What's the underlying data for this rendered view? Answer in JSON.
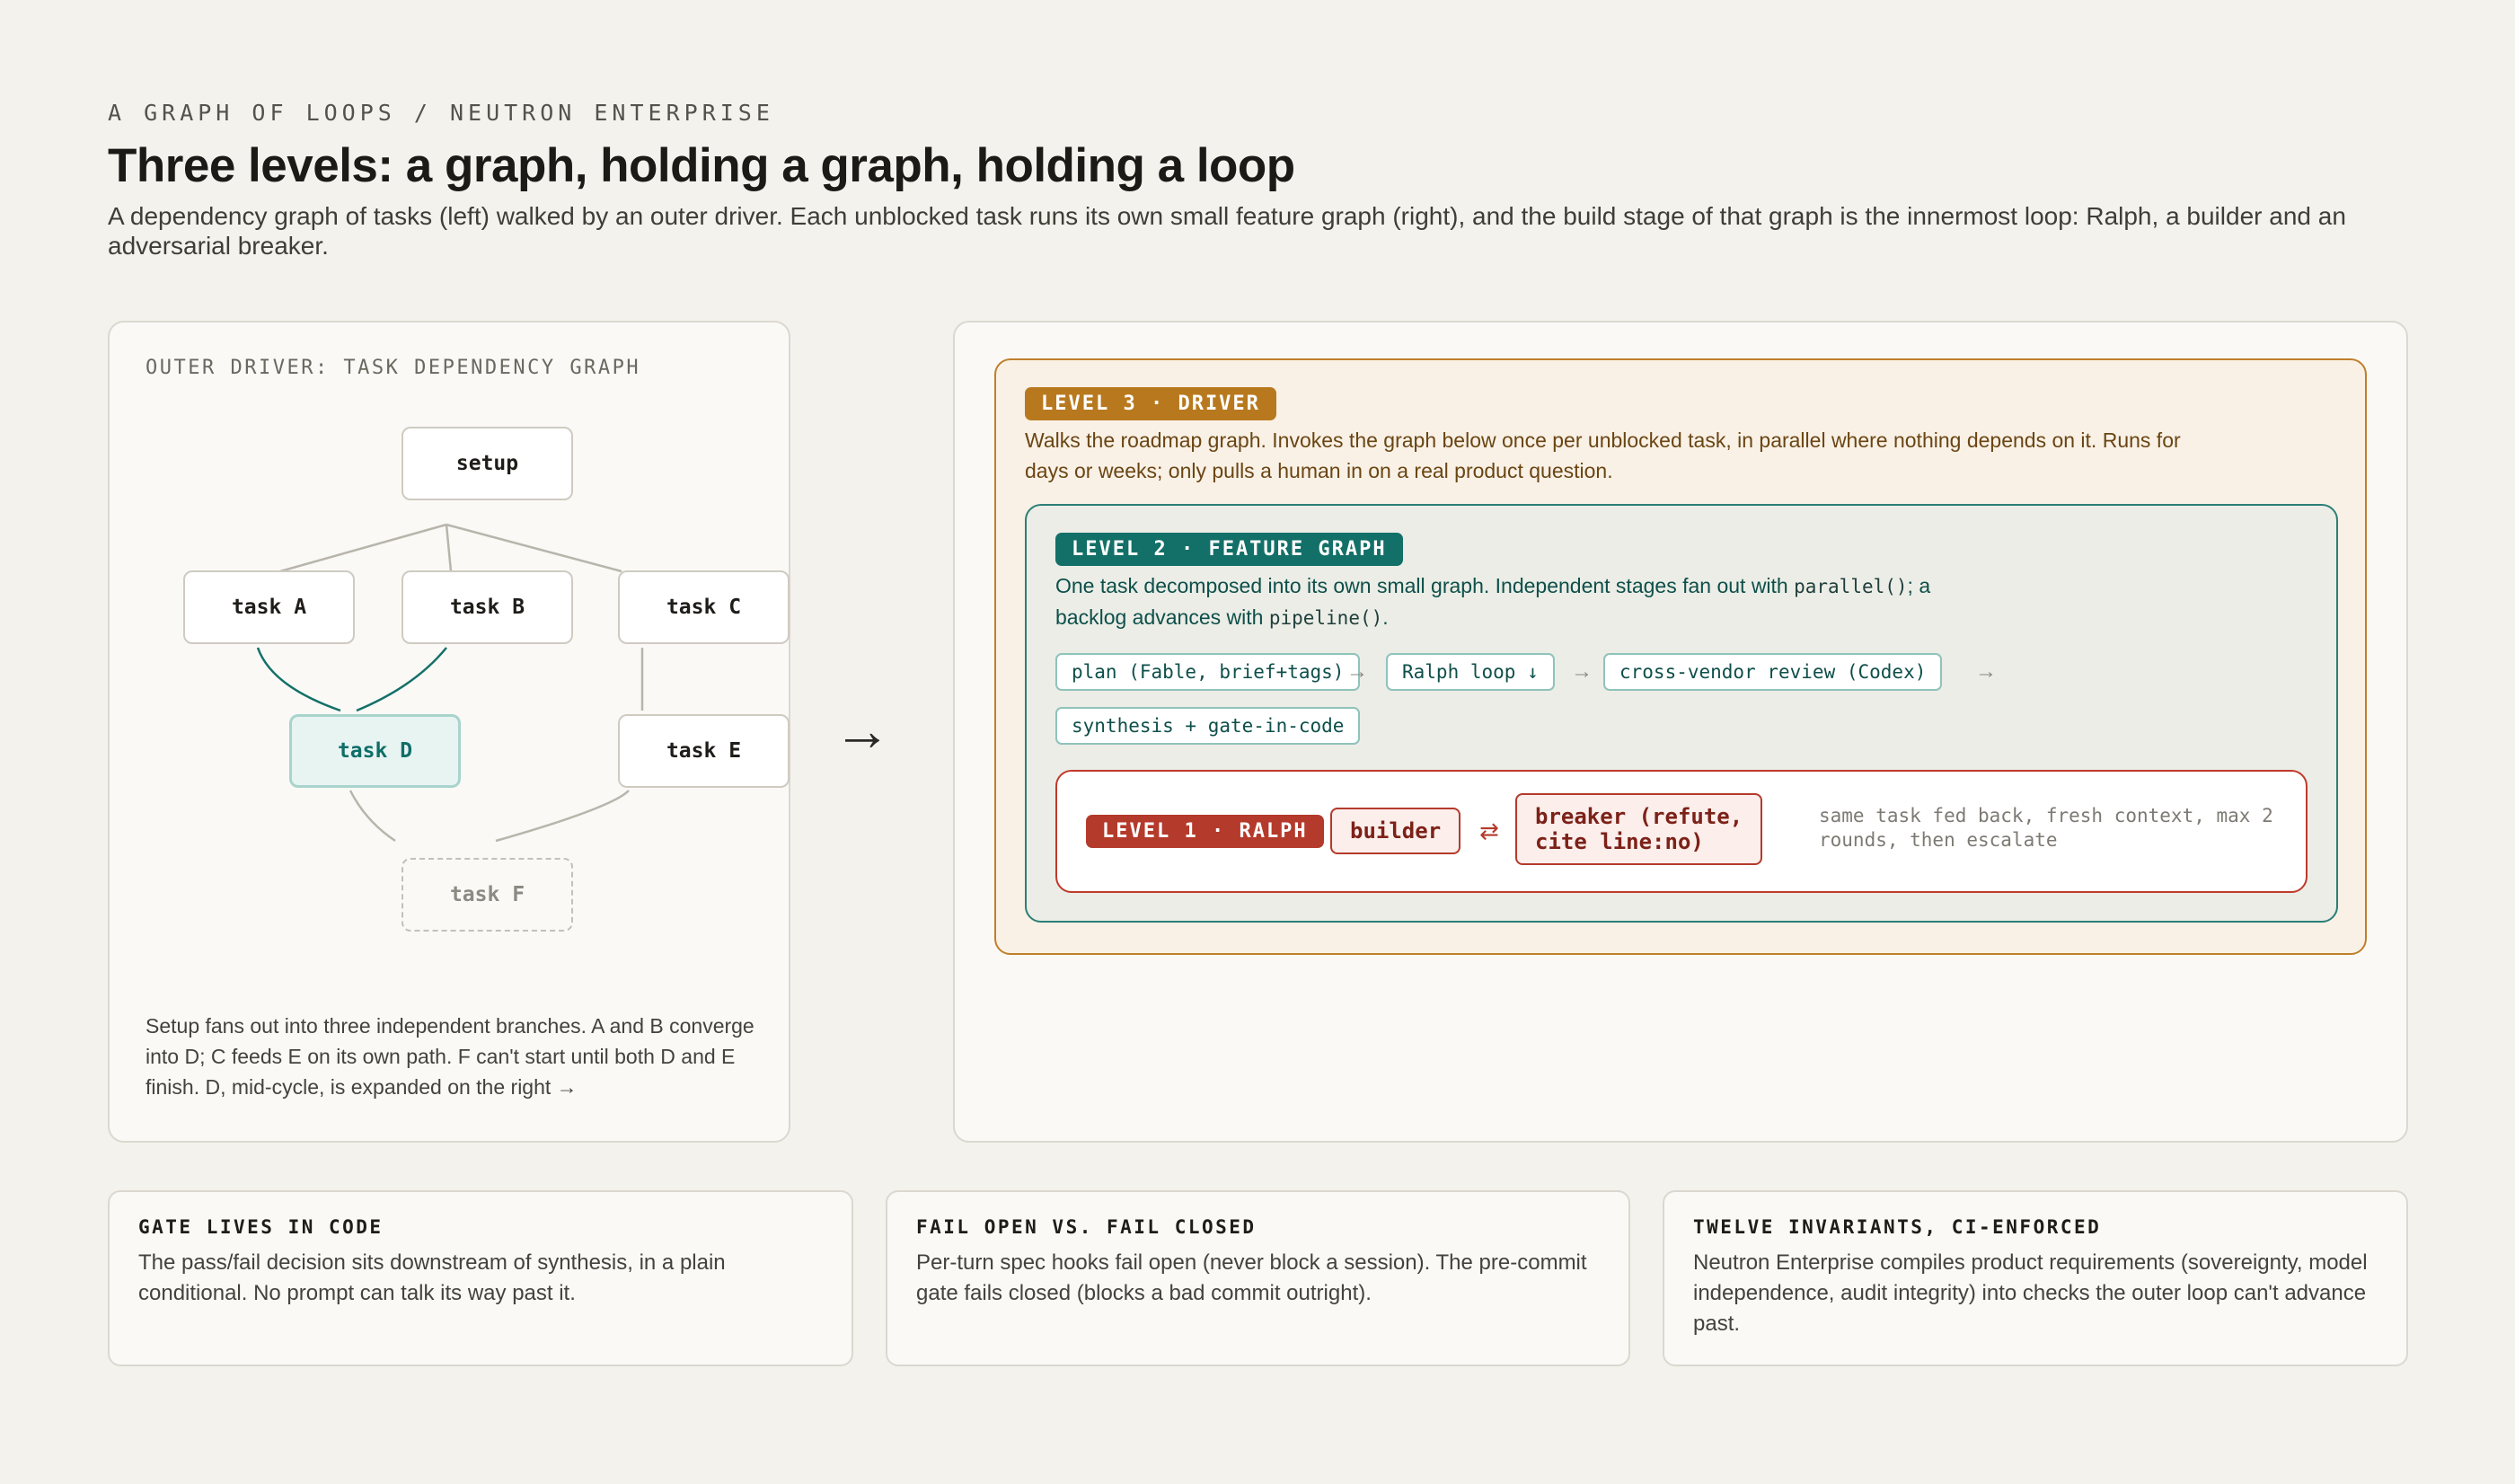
{
  "header": {
    "eyebrow": "A GRAPH OF LOOPS / NEUTRON ENTERPRISE",
    "title": "Three levels: a graph, holding a graph, holding a loop",
    "subtitle": "A dependency graph of tasks (left) walked by an outer driver. Each unblocked task runs its own small feature graph (right), and the build stage of that graph is the innermost loop: Ralph, a builder and an adversarial breaker."
  },
  "outer_graph": {
    "heading": "OUTER DRIVER: TASK DEPENDENCY GRAPH",
    "nodes": {
      "setup": "setup",
      "task_a": "task A",
      "task_b": "task B",
      "task_c": "task C",
      "task_d": "task D",
      "task_e": "task E",
      "task_f": "task F"
    },
    "caption": "Setup fans out into three independent branches. A and B converge into D; C feeds E on its own path. F can't start until both D and E finish. D, mid-cycle, is expanded on the right →"
  },
  "transition_arrow": "→",
  "level3": {
    "badge": "LEVEL 3 · DRIVER",
    "description": "Walks the roadmap graph. Invokes the graph below once per unblocked task, in parallel where nothing depends on it. Runs for days or weeks; only pulls a human in on a real product question."
  },
  "level2": {
    "badge": "LEVEL 2 · FEATURE GRAPH",
    "desc_part1": "One task decomposed into its own small graph. Independent stages fan out with ",
    "desc_code1": "parallel()",
    "desc_part2": "; a backlog advances with ",
    "desc_code2": "pipeline()",
    "desc_part3": ".",
    "stages": {
      "plan": "plan (Fable, brief+tags)",
      "ralph": "Ralph loop ↓",
      "review": "cross-vendor review (Codex)",
      "synthesis": "synthesis + gate-in-code"
    },
    "arrow": "→"
  },
  "level1": {
    "badge": "LEVEL 1 · RALPH",
    "builder": "builder",
    "swap_symbol": "⇄",
    "breaker_line1": "breaker (refute,",
    "breaker_line2": "cite line:no)",
    "note": "same task fed back, fresh context, max 2 rounds, then escalate"
  },
  "cards": [
    {
      "title": "GATE LIVES IN CODE",
      "body": "The pass/fail decision sits downstream of synthesis, in a plain conditional. No prompt can talk its way past it."
    },
    {
      "title": "FAIL OPEN VS. FAIL CLOSED",
      "body": "Per-turn spec hooks fail open (never block a session). The pre-commit gate fails closed (blocks a bad commit outright)."
    },
    {
      "title": "TWELVE INVARIANTS, CI-ENFORCED",
      "body": "Neutron Enterprise compiles product requirements (sovereignty, model independence, audit integrity) into checks the outer loop can't advance past."
    }
  ],
  "colors": {
    "background": "#f4f2ed",
    "level3_accent": "#b8791e",
    "level2_accent": "#137068",
    "level1_accent": "#b43a2c",
    "active_node": "#0e6e68"
  }
}
